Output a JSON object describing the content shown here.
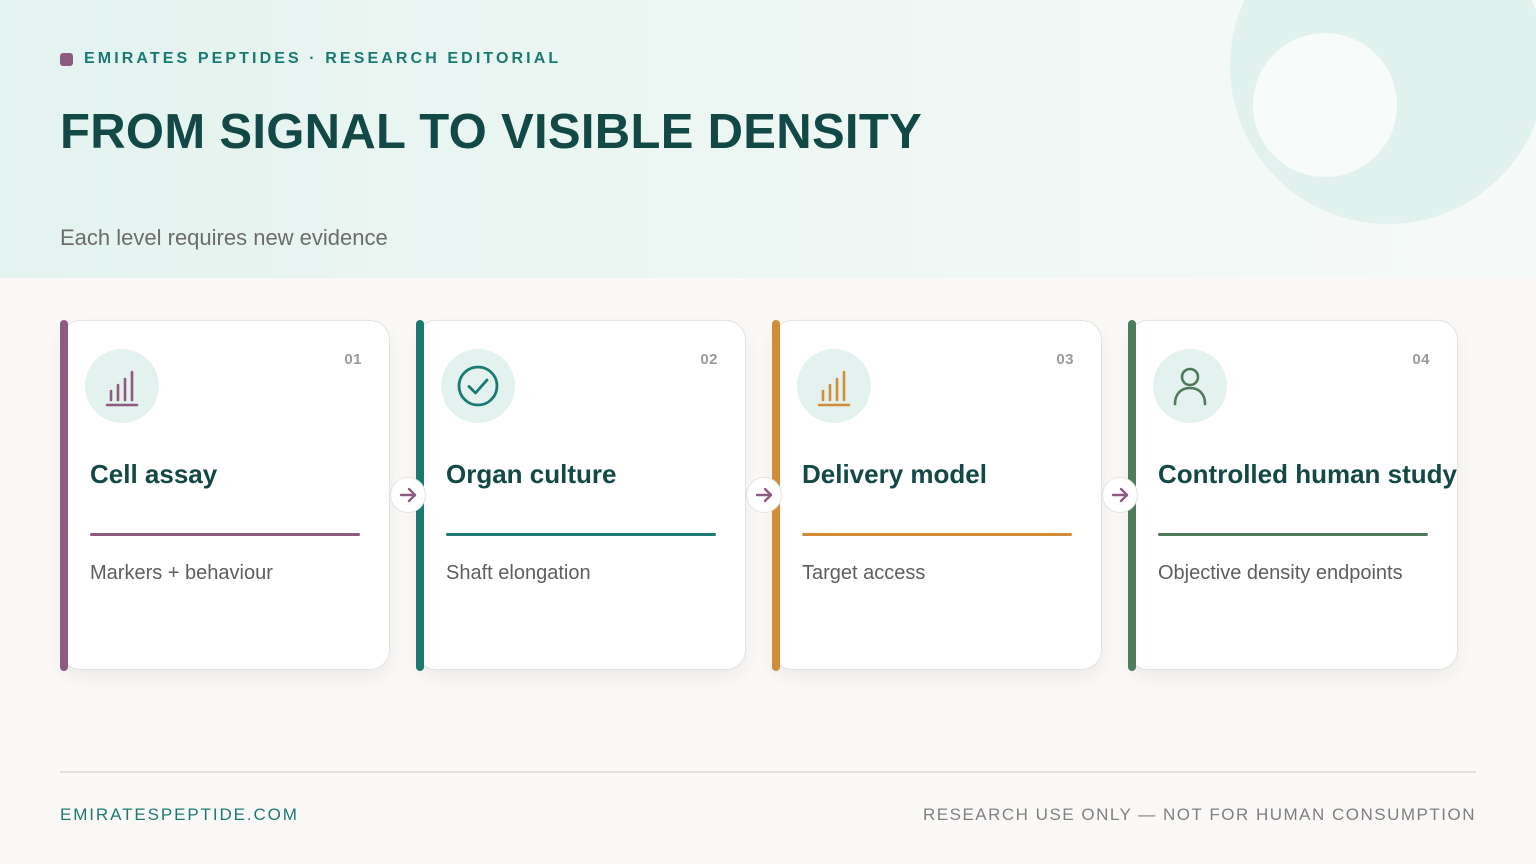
{
  "header": {
    "eyebrow": "EMIRATES PEPTIDES · RESEARCH EDITORIAL",
    "title": "FROM SIGNAL TO VISIBLE DENSITY",
    "subtitle": "Each level requires new evidence"
  },
  "colors": {
    "primary": "#124845",
    "teal": "#1a7a72",
    "accent": "#8e5b80"
  },
  "steps": [
    {
      "number": "01",
      "title": "Cell assay",
      "description": "Markers + behaviour",
      "icon": "bar-chart-icon",
      "color": "#8e5b80"
    },
    {
      "number": "02",
      "title": "Organ culture",
      "description": "Shaft elongation",
      "icon": "check-circle-icon",
      "color": "#1a7a72"
    },
    {
      "number": "03",
      "title": "Delivery model",
      "description": "Target access",
      "icon": "bar-chart-icon",
      "color": "#d38d38"
    },
    {
      "number": "04",
      "title": "Controlled human study",
      "description": "Objective density endpoints",
      "icon": "person-icon",
      "color": "#4f7a5b"
    }
  ],
  "footer": {
    "website": "EMIRATESPEPTIDE.COM",
    "disclaimer": "RESEARCH USE ONLY — NOT FOR HUMAN CONSUMPTION"
  }
}
